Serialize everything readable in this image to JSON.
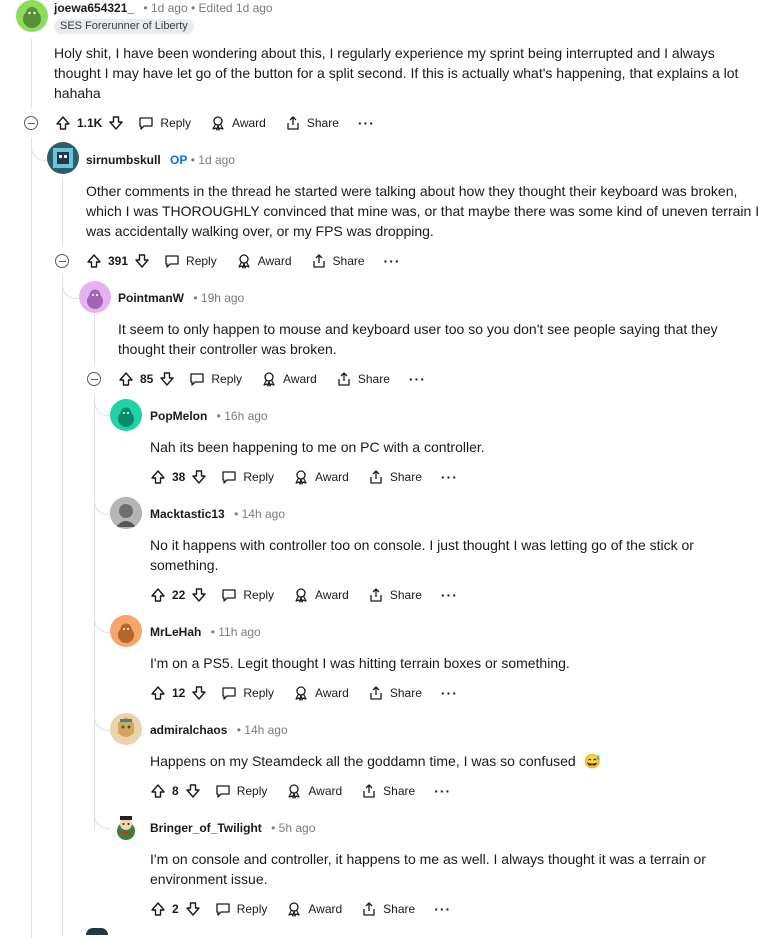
{
  "comments": [
    {
      "author": "joewa654321_",
      "op": "",
      "time": "1d ago",
      "edited": "Edited 1d ago",
      "flair": "SES Forerunner of Liberty",
      "avatar_color": "#8fdc5c",
      "lines": [
        "Holy shit, I have been wondering about this, I regularly experience my sprint being interrupted and I always",
        "thought I may have let go of the button for a split second. If this is actually what's happening, that explains a lot",
        "hahaha"
      ],
      "votes": "1.1K"
    },
    {
      "author": "sirnumbskull",
      "op": "OP",
      "time": "1d ago",
      "avatar_color": "#2b5f6b",
      "lines": [
        "Other comments in the thread he started were talking about how they thought their keyboard was broken,",
        "which I was THOROUGHLY convinced that mine was, or that maybe there was some kind of uneven terrain I",
        "was accidentally walking over, or my FPS was dropping."
      ],
      "votes": "391"
    },
    {
      "author": "PointmanW",
      "time": "19h ago",
      "avatar_color": "#e6b3f2",
      "lines": [
        "It seem to only happen to mouse and keyboard user too so you don't see people saying that they",
        "thought their controller was broken."
      ],
      "votes": "85"
    },
    {
      "author": "PopMelon",
      "time": "16h ago",
      "avatar_color": "#1fd3a5",
      "lines": [
        "Nah its been happening to me on PC with a controller."
      ],
      "votes": "38"
    },
    {
      "author": "Macktastic13",
      "time": "14h ago",
      "avatar_color": "#9a9a9a",
      "lines": [
        "No it happens with controller too on console. I just thought I was letting go of the stick or",
        "something."
      ],
      "votes": "22"
    },
    {
      "author": "MrLeHah",
      "time": "11h ago",
      "avatar_color": "#f5a66a",
      "lines": [
        "I'm on a PS5. Legit thought I was hitting terrain boxes or something."
      ],
      "votes": "12"
    },
    {
      "author": "admiralchaos",
      "time": "14h ago",
      "avatar_color": "#d9a35b",
      "lines": [
        "Happens on my Steamdeck all the goddamn time, I was so confused"
      ],
      "emoji": "😅",
      "votes": "8"
    },
    {
      "author": "Bringer_of_Twilight",
      "time": "5h ago",
      "avatar_color": "#3f7d3a",
      "lines": [
        "I'm on console and controller, it happens to me as well. I always thought it was a terrain or",
        "environment issue."
      ],
      "votes": "2"
    }
  ],
  "labels": {
    "reply": "Reply",
    "award": "Award",
    "share": "Share",
    "more": "···",
    "dot": "•"
  },
  "icons": [
    "upvote-icon",
    "downvote-icon",
    "comment-icon",
    "award-icon",
    "share-icon",
    "collapse-icon",
    "more-icon"
  ]
}
